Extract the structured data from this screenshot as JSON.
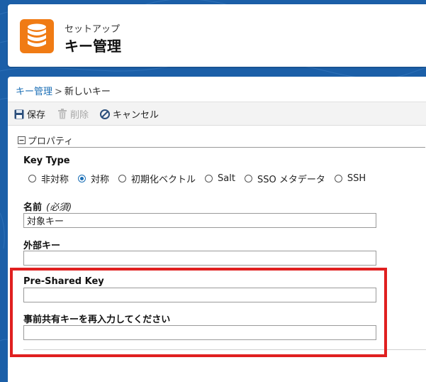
{
  "header": {
    "subtitle": "セットアップ",
    "title": "キー管理"
  },
  "breadcrumb": {
    "link": "キー管理",
    "separator": ">",
    "current": "新しいキー"
  },
  "toolbar": {
    "save_label": "保存",
    "delete_label": "削除",
    "cancel_label": "キャンセル"
  },
  "section": {
    "title": "プロパティ"
  },
  "key_type": {
    "label": "Key Type",
    "options": [
      "非対称",
      "対称",
      "初期化ベクトル",
      "Salt",
      "SSO メタデータ",
      "SSH"
    ],
    "selected": "対称"
  },
  "fields": {
    "name_label": "名前",
    "name_required": "(必須)",
    "name_value": "対象キー",
    "external_key_label": "外部キー",
    "external_key_value": "",
    "psk_label": "Pre-Shared Key",
    "psk_value": "",
    "psk_confirm_label": "事前共有キーを再入力してください",
    "psk_confirm_value": ""
  },
  "colors": {
    "background": "#1b5fa8",
    "app_icon": "#f07b14",
    "link": "#1a6eb5",
    "highlight": "#e02020"
  },
  "icons": {
    "app": "database-icon",
    "save": "floppy-disk-icon",
    "delete": "trash-icon",
    "cancel": "prohibited-icon",
    "section": "collapse-minus-icon"
  }
}
